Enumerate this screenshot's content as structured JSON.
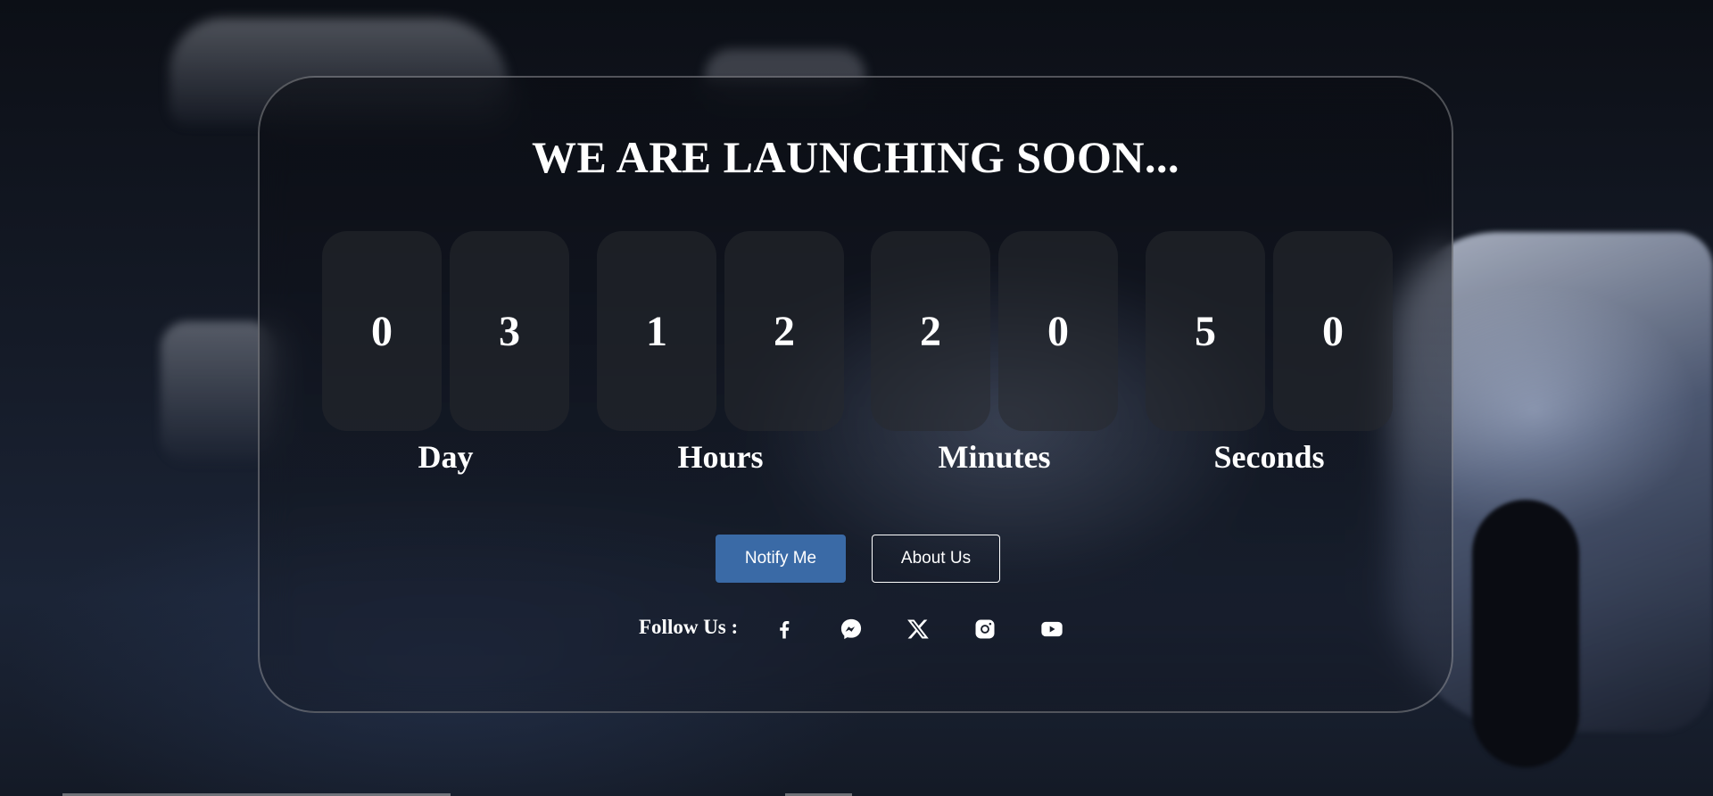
{
  "heading": "WE ARE LAUNCHING SOON...",
  "countdown": [
    {
      "label": "Day",
      "digits": [
        "0",
        "3"
      ]
    },
    {
      "label": "Hours",
      "digits": [
        "1",
        "2"
      ]
    },
    {
      "label": "Minutes",
      "digits": [
        "2",
        "0"
      ]
    },
    {
      "label": "Seconds",
      "digits": [
        "5",
        "0"
      ]
    }
  ],
  "buttons": {
    "notify": "Notify Me",
    "about": "About Us"
  },
  "social": {
    "follow_label": "Follow Us :",
    "icons": [
      "facebook-icon",
      "messenger-icon",
      "x-icon",
      "instagram-icon",
      "youtube-icon"
    ]
  },
  "colors": {
    "notify_button": "#3a6aa6",
    "text": "#ffffff"
  }
}
